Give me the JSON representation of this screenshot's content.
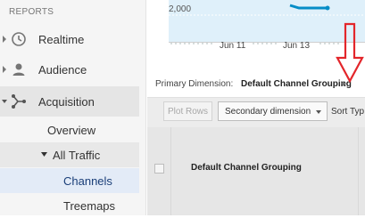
{
  "sidebar": {
    "section_label": "REPORTS",
    "items": [
      {
        "label": "Realtime",
        "icon": "clock-icon"
      },
      {
        "label": "Audience",
        "icon": "person-icon"
      },
      {
        "label": "Acquisition",
        "icon": "acquisition-icon"
      }
    ],
    "sub_items": [
      "Overview",
      "All Traffic",
      "Channels",
      "Treemaps"
    ]
  },
  "chart": {
    "y_label": "2,000",
    "x_ticks": [
      "Jun 11",
      "Jun 13"
    ],
    "fill_color": "#dff0fa",
    "line_color": "#058dc7"
  },
  "dimension": {
    "label": "Primary Dimension:",
    "value": "Default Channel Grouping"
  },
  "toolbar": {
    "plot_rows": "Plot Rows",
    "secondary_dimension": "Secondary dimension",
    "sort_type": "Sort Typ"
  },
  "table": {
    "column_header": "Default Channel Grouping"
  },
  "annotation_color": "#e3262b"
}
